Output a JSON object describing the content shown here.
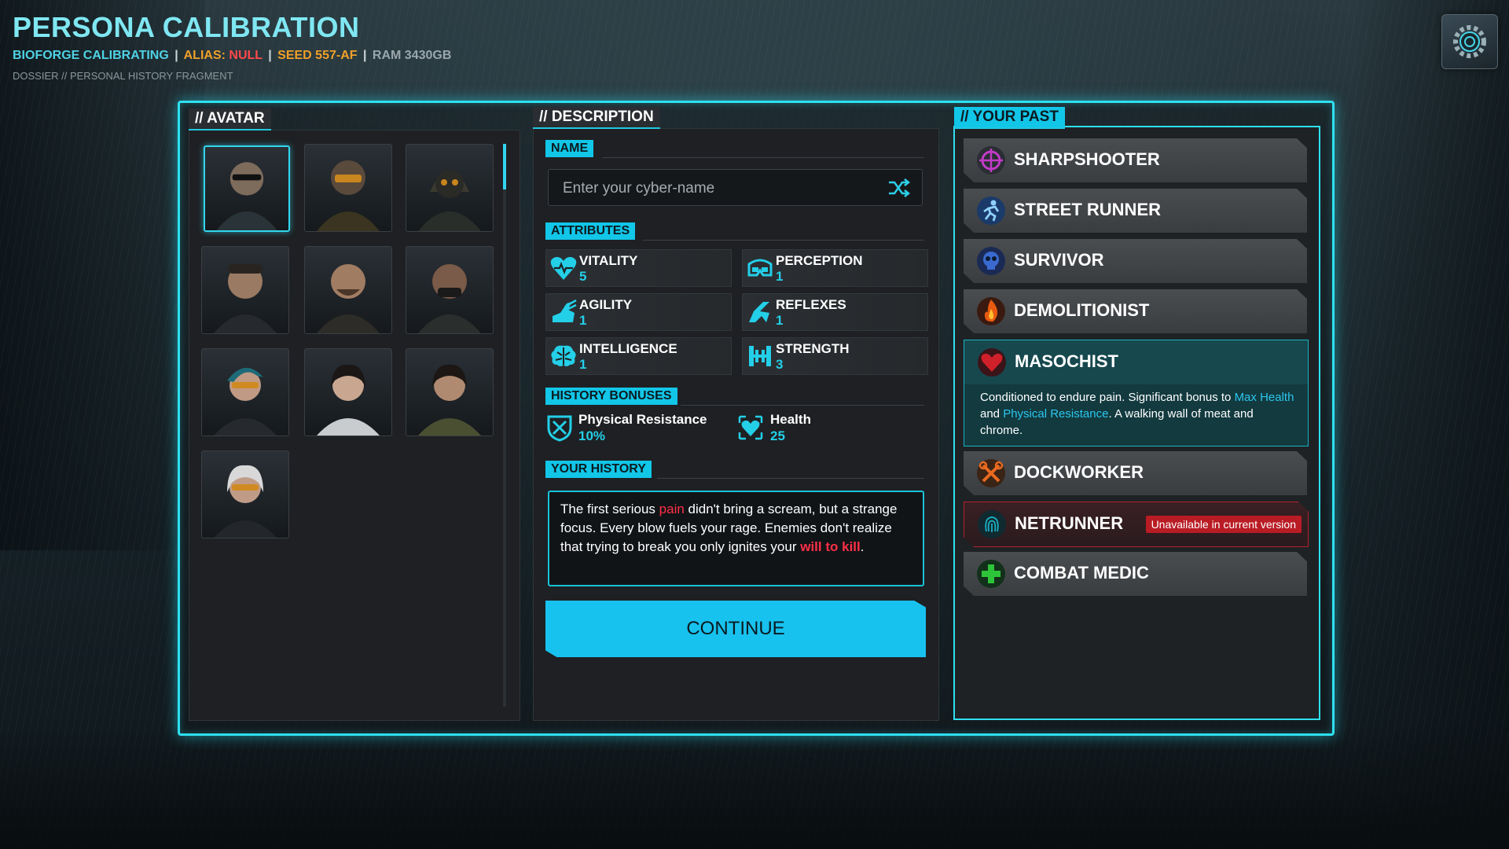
{
  "header": {
    "title": "PERSONA CALIBRATION",
    "status": {
      "bioforge": "BIOFORGE CALIBRATING",
      "sep1": "|",
      "alias_label": "ALIAS: ",
      "alias_value": "NULL",
      "sep2": "|",
      "seed": "SEED 557-AF",
      "sep3": "|",
      "ram": "RAM 3430GB"
    },
    "dossier": "DOSSIER // PERSONAL HISTORY FRAGMENT",
    "settings_icon": "gear-icon"
  },
  "avatar_panel": {
    "tag": "// AVATAR",
    "avatars": [
      "avatar-1",
      "avatar-2",
      "avatar-3",
      "avatar-4",
      "avatar-5",
      "avatar-6",
      "avatar-7",
      "avatar-8",
      "avatar-9",
      "avatar-10"
    ],
    "selected_index": 0
  },
  "description_panel": {
    "tag": "// DESCRIPTION",
    "name_label": "NAME",
    "name_placeholder": "Enter your cyber-name",
    "name_value": "",
    "attributes_label": "ATTRIBUTES",
    "attributes": [
      {
        "name": "VITALITY",
        "value": "5",
        "icon": "heart-pulse-icon"
      },
      {
        "name": "PERCEPTION",
        "value": "1",
        "icon": "goggles-icon"
      },
      {
        "name": "AGILITY",
        "value": "1",
        "icon": "winged-boot-icon"
      },
      {
        "name": "REFLEXES",
        "value": "1",
        "icon": "reflex-icon"
      },
      {
        "name": "INTELLIGENCE",
        "value": "1",
        "icon": "brain-icon"
      },
      {
        "name": "STRENGTH",
        "value": "3",
        "icon": "dumbbell-icon"
      }
    ],
    "history_bonuses_label": "HISTORY BONUSES",
    "bonuses": [
      {
        "name": "Physical Resistance",
        "value": "10%",
        "icon": "shield-icon"
      },
      {
        "name": "Health",
        "value": "25",
        "icon": "heart-icon"
      }
    ],
    "history_label": "YOUR HISTORY",
    "history": {
      "p1": "The first serious ",
      "pain": "pain",
      "p2": " didn't bring a scream, but a strange focus. Every blow fuels your rage. Enemies don't realize that trying to break you only ignites your ",
      "kill": "will to kill",
      "p3": "."
    },
    "continue_label": "CONTINUE"
  },
  "past_panel": {
    "tag": "// YOUR PAST",
    "items": [
      {
        "name": "SHARPSHOOTER",
        "icon": "crosshair-icon",
        "color": "#c23bc8"
      },
      {
        "name": "STREET RUNNER",
        "icon": "runner-icon",
        "color": "#2a8fe0"
      },
      {
        "name": "SURVIVOR",
        "icon": "skull-icon",
        "color": "#3a6ad0"
      },
      {
        "name": "DEMOLITIONIST",
        "icon": "flame-icon",
        "color": "#e85a10"
      },
      {
        "name": "MASOCHIST",
        "icon": "heart-icon",
        "color": "#d0202a"
      },
      {
        "name": "DOCKWORKER",
        "icon": "wrench-icon",
        "color": "#e86a20"
      },
      {
        "name": "NETRUNNER",
        "icon": "fingerprint-icon",
        "color": "#1ab1c2"
      },
      {
        "name": "COMBAT MEDIC",
        "icon": "medical-cross-icon",
        "color": "#2ec43a"
      }
    ],
    "expanded": {
      "d1": "Conditioned to endure pain. Significant bonus to ",
      "link1": "Max Health",
      "d2": " and ",
      "link2": "Physical Resistance",
      "d3": ". A walking wall of meat and chrome."
    },
    "locked_badge": "Unavailable in current version"
  },
  "colors": {
    "accent": "#2ee0f0",
    "button": "#18c2ef",
    "danger": "#b91c24",
    "value": "#24cfe8"
  }
}
